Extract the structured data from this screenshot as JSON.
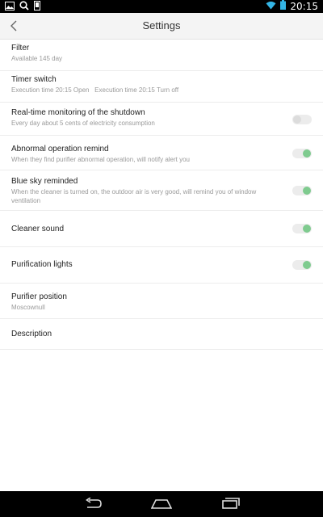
{
  "status_bar": {
    "time": "20:15",
    "icons": [
      "gallery-icon",
      "search-icon",
      "phone-icon",
      "wifi-icon",
      "battery-icon"
    ]
  },
  "header": {
    "title": "Settings",
    "back_icon": "chevron-left-icon"
  },
  "items": [
    {
      "title": "Filter",
      "subtitle": "Available 145 day"
    },
    {
      "title": "Timer switch",
      "subtitle": "Execution time 20:15 Open   Execution time 20:15 Turn off"
    },
    {
      "title": "Real-time monitoring of the shutdown",
      "subtitle": "Every day about 5 cents of electricity consumption",
      "toggle": "off"
    },
    {
      "title": "Abnormal operation remind",
      "subtitle": "When they find purifier abnormal operation, will notify alert you",
      "toggle": "on"
    },
    {
      "title": "Blue sky reminded",
      "subtitle": "When the cleaner is turned on, the outdoor air is very good, will remind you of window ventilation",
      "toggle": "on"
    },
    {
      "title": "Cleaner sound",
      "toggle": "on"
    },
    {
      "title": "Purification lights",
      "toggle": "on"
    },
    {
      "title": "Purifier position",
      "subtitle": "Moscownull"
    },
    {
      "title": "Description"
    }
  ],
  "colors": {
    "toggle_on": "#7fcb8f",
    "toggle_off": "#dcdcdc",
    "header_bg": "#f4f4f4"
  },
  "nav_bar": {
    "icons": [
      "back-icon",
      "home-icon",
      "recent-apps-icon"
    ]
  }
}
